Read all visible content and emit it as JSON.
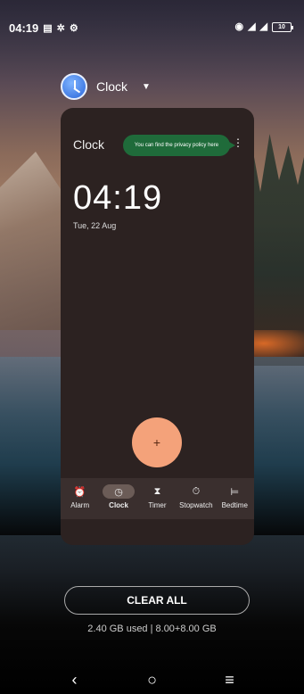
{
  "status_bar": {
    "time": "04:19",
    "left_icons": [
      "clipboard-icon",
      "gear-icon",
      "settings-cog-icon"
    ],
    "right_icons": [
      "vibrate-icon",
      "no-signal-icon",
      "no-signal-icon-2"
    ],
    "battery": "10"
  },
  "app_header": {
    "name": "Clock",
    "icon": "clock-app-icon"
  },
  "card": {
    "title": "Clock",
    "privacy_tip": "You can find the privacy policy here",
    "time": "04:19",
    "date": "Tue, 22 Aug",
    "fab_label": "+",
    "nav": [
      {
        "label": "Alarm",
        "icon": "alarm-icon",
        "glyph": "⏰",
        "active": false
      },
      {
        "label": "Clock",
        "icon": "clock-icon",
        "glyph": "◷",
        "active": true
      },
      {
        "label": "Timer",
        "icon": "hourglass-icon",
        "glyph": "⧗",
        "active": false
      },
      {
        "label": "Stopwatch",
        "icon": "stopwatch-icon",
        "glyph": "⏱",
        "active": false
      },
      {
        "label": "Bedtime",
        "icon": "bed-icon",
        "glyph": "⊨",
        "active": false
      }
    ]
  },
  "recents": {
    "clear_all": "CLEAR ALL",
    "memory": "2.40 GB used | 8.00+8.00 GB"
  },
  "system_nav": {
    "back": "‹",
    "home": "○",
    "recents": "≡"
  },
  "colors": {
    "card_bg": "#2c2221",
    "fab": "#f4a27a",
    "privacy_pill": "#1f6b3a",
    "nav_active": "#6b5c57"
  }
}
